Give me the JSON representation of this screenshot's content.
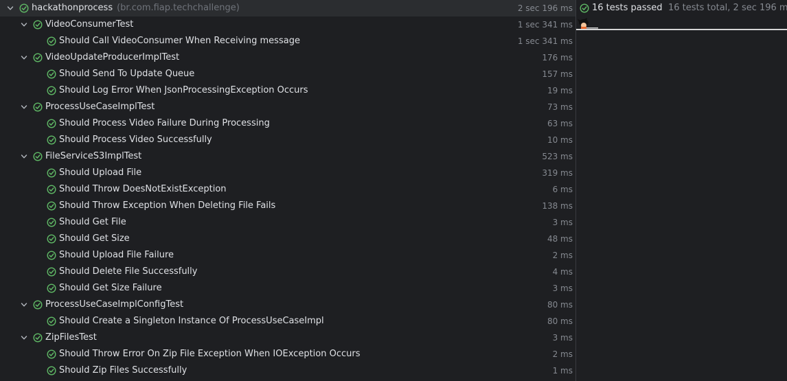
{
  "colors": {
    "pass": "#5fb865",
    "text": "#dfe1e5",
    "muted": "#868a91",
    "package": "#6f737a",
    "background": "#1e1f22",
    "selected_row": "#2b2d30"
  },
  "icons": {
    "expand": "chevron-down-icon",
    "status": "check-circle-icon"
  },
  "root": {
    "name": "hackathonprocess",
    "package": "(br.com.fiap.techchallenge)",
    "duration": "2 sec 196 ms"
  },
  "suites": [
    {
      "name": "VideoConsumerTest",
      "duration": "1 sec 341 ms",
      "tests": [
        {
          "name": "Should Call VideoConsumer When Receiving message",
          "duration": "1 sec 341 ms"
        }
      ]
    },
    {
      "name": "VideoUpdateProducerImplTest",
      "duration": "176 ms",
      "tests": [
        {
          "name": "Should Send To Update Queue",
          "duration": "157 ms"
        },
        {
          "name": "Should Log Error When JsonProcessingException Occurs",
          "duration": "19 ms"
        }
      ]
    },
    {
      "name": "ProcessUseCaseImplTest",
      "duration": "73 ms",
      "tests": [
        {
          "name": "Should Process Video Failure During Processing",
          "duration": "63 ms"
        },
        {
          "name": "Should Process Video Successfully",
          "duration": "10 ms"
        }
      ]
    },
    {
      "name": "FileServiceS3ImplTest",
      "duration": "523 ms",
      "tests": [
        {
          "name": "Should Upload File",
          "duration": "319 ms"
        },
        {
          "name": "Should Throw DoesNotExistException",
          "duration": "6 ms"
        },
        {
          "name": "Should Throw Exception When Deleting File Fails",
          "duration": "138 ms"
        },
        {
          "name": "Should Get File",
          "duration": "3 ms"
        },
        {
          "name": "Should Get Size",
          "duration": "48 ms"
        },
        {
          "name": "Should Upload File Failure",
          "duration": "2 ms"
        },
        {
          "name": "Should Delete File Successfully",
          "duration": "4 ms"
        },
        {
          "name": "Should Get Size Failure",
          "duration": "3 ms"
        }
      ]
    },
    {
      "name": "ProcessUseCaseImplConfigTest",
      "duration": "80 ms",
      "tests": [
        {
          "name": "Should Create a Singleton Instance Of ProcessUseCaseImpl",
          "duration": "80 ms"
        }
      ]
    },
    {
      "name": "ZipFilesTest",
      "duration": "3 ms",
      "tests": [
        {
          "name": "Should Throw Error On Zip File Exception When IOException Occurs",
          "duration": "2 ms"
        },
        {
          "name": "Should Zip Files Successfully",
          "duration": "1 ms"
        }
      ]
    }
  ],
  "status": {
    "passed_label": "16 tests passed",
    "total_label": "16 tests total, 2 sec 196 ms",
    "progress_fraction": 1.0
  }
}
